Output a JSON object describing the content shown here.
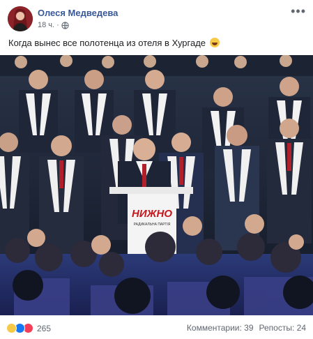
{
  "post": {
    "author": "Олеся Медведева",
    "time": "18 ч.",
    "privacy_icon": "globe-icon",
    "more_icon": "more-dots-icon",
    "text": "Когда вынес все полотенца из отеля в Хургаде",
    "text_emoji": "rofl-emoji-icon"
  },
  "photo": {
    "podium_sign": "НИЖНО",
    "podium_sub": "РАДИКАЛЬНА ПАРТІЯ"
  },
  "footer": {
    "reactions_count": "265",
    "comments": "Комментарии: 39",
    "shares": "Репосты: 24"
  },
  "colors": {
    "author_link": "#385898",
    "muted": "#606770",
    "like": "#1877f2",
    "love": "#f33e58",
    "haha": "#f7c948"
  }
}
